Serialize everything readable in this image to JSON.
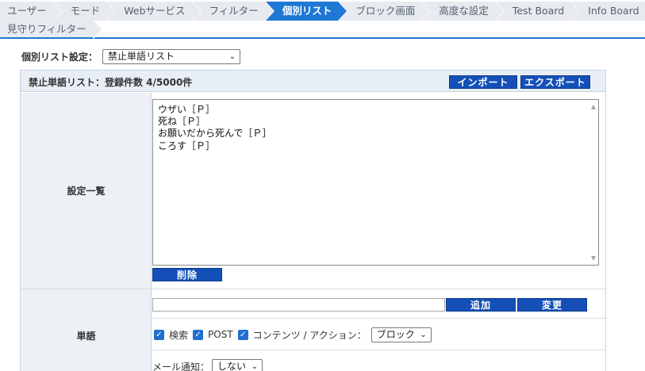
{
  "tabs": {
    "row1": [
      "ユーザー",
      "モード",
      "Webサービス",
      "フィルター",
      "個別リスト",
      "ブロック画面",
      "高度な設定",
      "Test Board",
      "Info Board"
    ],
    "row2": [
      "見守りフィルター"
    ],
    "active": "個別リスト"
  },
  "setting": {
    "label": "個別リスト設定：",
    "selected": "禁止単語リスト"
  },
  "panel": {
    "title": "禁止単語リスト：登録件数 4/5000件",
    "import_label": "インポート",
    "export_label": "エクスポート"
  },
  "settings_list": {
    "label": "設定一覧",
    "items": [
      "ウザい［Ｐ］",
      "死ね［Ｐ］",
      "お願いだから死んで［Ｐ］",
      "ころす［Ｐ］"
    ],
    "delete_label": "削除"
  },
  "word": {
    "label": "単語",
    "input_value": "",
    "add_label": "追加",
    "change_label": "変更",
    "check_search": "検索",
    "check_post": "POST",
    "check_content": "コンテンツ / アクション：",
    "action_selected": "ブロック",
    "mail_label": "メール通知：",
    "mail_selected": "しない"
  },
  "colors": {
    "accent": "#1e78d4",
    "button": "#1450b8",
    "tab_bg": "#e7ebf0"
  }
}
